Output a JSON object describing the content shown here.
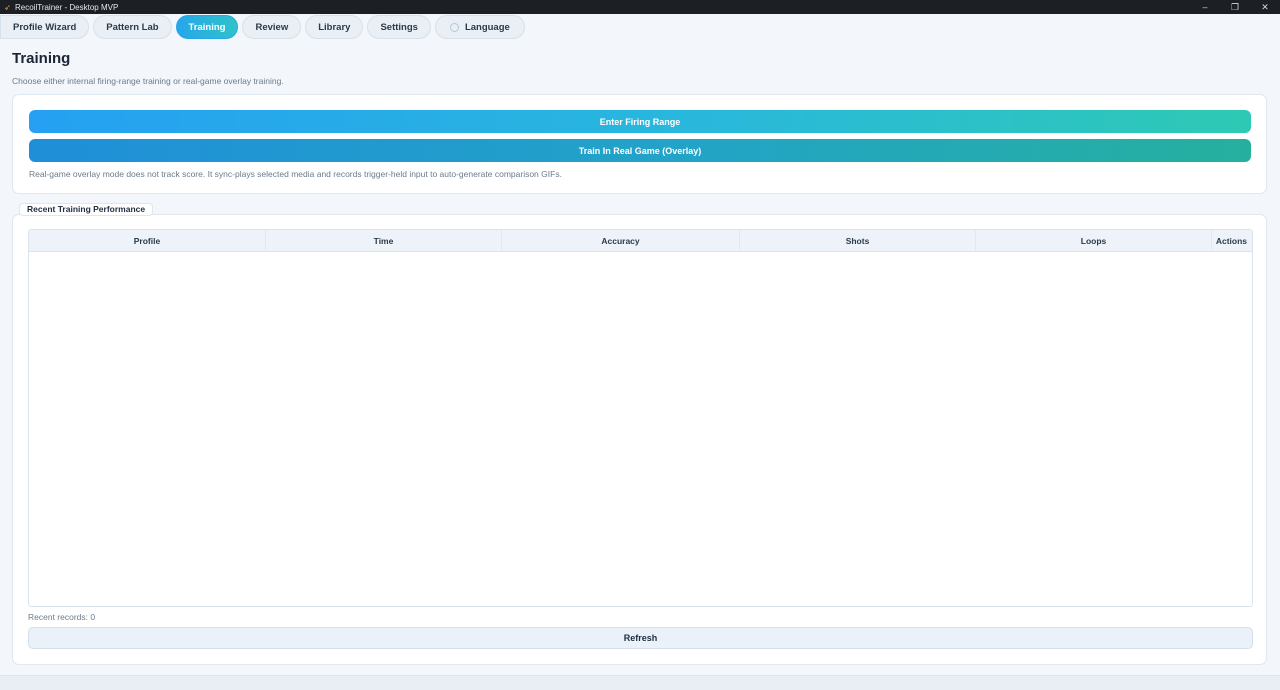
{
  "window": {
    "title": "RecoilTrainer - Desktop MVP",
    "minimize_glyph": "–",
    "maximize_glyph": "❐",
    "close_glyph": "✕"
  },
  "tabs": [
    {
      "label": "Profile Wizard",
      "active": false
    },
    {
      "label": "Pattern Lab",
      "active": false
    },
    {
      "label": "Training",
      "active": true
    },
    {
      "label": "Review",
      "active": false
    },
    {
      "label": "Library",
      "active": false
    },
    {
      "label": "Settings",
      "active": false
    },
    {
      "label": "Language",
      "active": false,
      "icon": "globe-icon"
    }
  ],
  "page": {
    "title": "Training",
    "subtitle": "Choose either internal firing-range training or real-game overlay training."
  },
  "training_actions": {
    "firing_range_label": "Enter Firing Range",
    "overlay_label": "Train In Real Game (Overlay)",
    "note": "Real-game overlay mode does not track score. It sync-plays selected media and records trigger-held input to auto-generate comparison GIFs."
  },
  "performance": {
    "group_title": "Recent Training Performance",
    "columns": [
      "Profile",
      "Time",
      "Accuracy",
      "Shots",
      "Loops",
      "Actions"
    ],
    "rows": [],
    "records_text": "Recent records: 0",
    "refresh_label": "Refresh"
  },
  "colors": {
    "accent_start": "#25a0f2",
    "accent_end": "#2ec9b4"
  }
}
